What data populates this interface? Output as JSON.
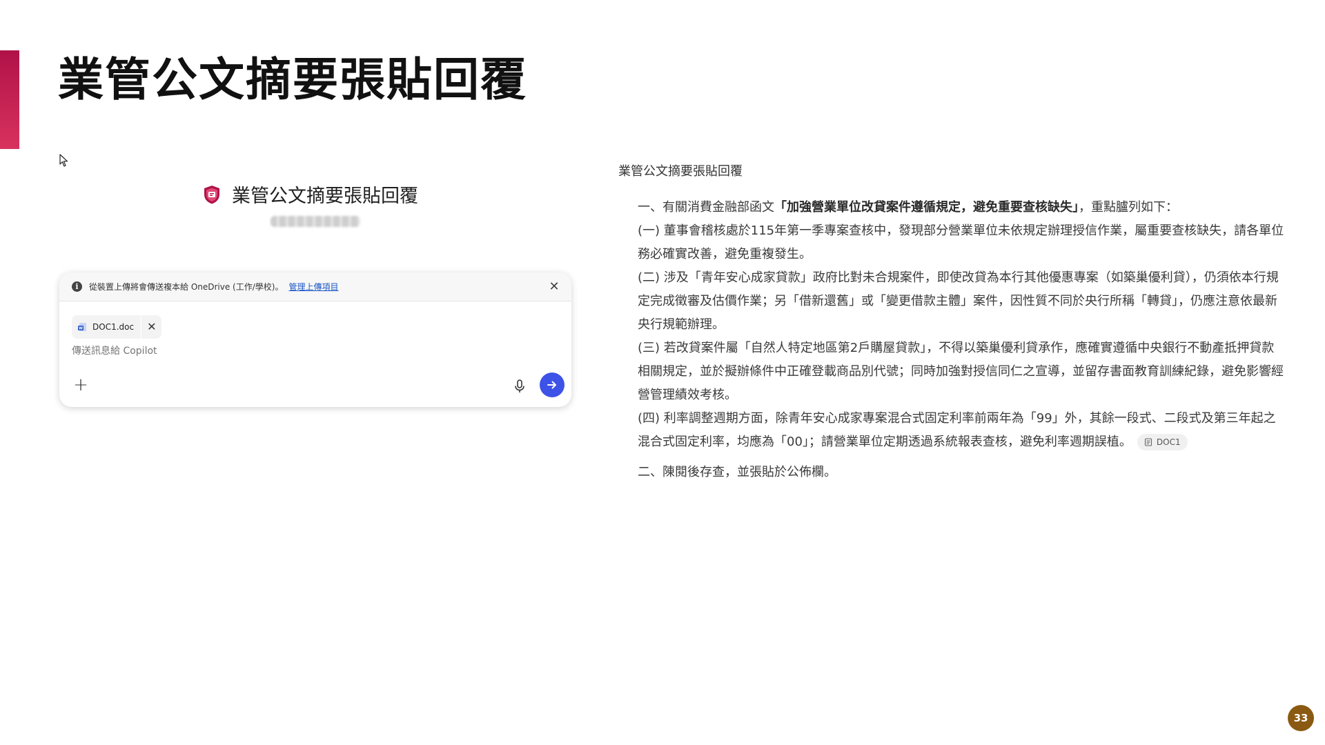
{
  "slide": {
    "title": "業管公文摘要張貼回覆",
    "page_number": "33",
    "accent_color": "#c41f50"
  },
  "agent": {
    "title": "業管公文摘要張貼回覆",
    "logo_icon": "copilot-agent-shield-icon"
  },
  "chat": {
    "info_text": "從裝置上傳將會傳送複本給 OneDrive (工作/學校)。",
    "info_link": "管理上傳項目",
    "attachment_name": "DOC1.doc",
    "input_placeholder": "傳送訊息給 Copilot",
    "send_color": "#3d52e6"
  },
  "response": {
    "heading": "業管公文摘要張貼回覆",
    "item1_prefix": "一、有關消費金融部函文",
    "item1_bold": "「加強營業單位改貸案件遵循規定，避免重要查核缺失」",
    "item1_suffix": "，重點臚列如下：",
    "p1": "(一) 董事會稽核處於115年第一季專案查核中，發現部分營業單位未依規定辦理授信作業，屬重要查核缺失，請各單位務必確實改善，避免重複發生。",
    "p2": "(二) 涉及「青年安心成家貸款」政府比對未合規案件，即使改貸為本行其他優惠專案（如築巢優利貸），仍須依本行規定完成徵審及估價作業；另「借新還舊」或「變更借款主體」案件，因性質不同於央行所稱「轉貸」，仍應注意依最新央行規範辦理。",
    "p3": "(三) 若改貸案件屬「自然人特定地區第2戶購屋貸款」，不得以築巢優利貸承作，應確實遵循中央銀行不動產抵押貸款相關規定，並於擬辦條件中正確登載商品別代號；同時加強對授信同仁之宣導，並留存書面教育訓練紀錄，避免影響經營管理績效考核。",
    "p4": "(四) 利率調整週期方面，除青年安心成家專案混合式固定利率前兩年為「99」外，其餘一段式、二段式及第三年起之混合式固定利率，均應為「00」；請營業單位定期透過系統報表查核，避免利率週期誤植。",
    "citation": "DOC1",
    "item2": "二、陳閱後存查，並張貼於公佈欄。"
  }
}
